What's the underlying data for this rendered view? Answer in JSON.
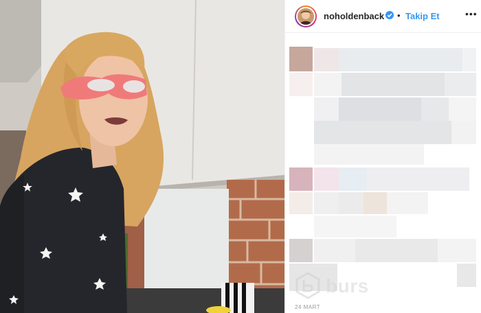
{
  "post": {
    "username": "noholdenback",
    "separator": "•",
    "follow_label": "Takip Et",
    "more_label": "•••",
    "date": "24 MART"
  },
  "watermark": {
    "text": "burs"
  },
  "icons": {
    "verified": "verified-badge-icon",
    "more": "more-options-icon"
  },
  "colors": {
    "accent": "#3897f0",
    "username": "#262626",
    "date": "#999999"
  }
}
